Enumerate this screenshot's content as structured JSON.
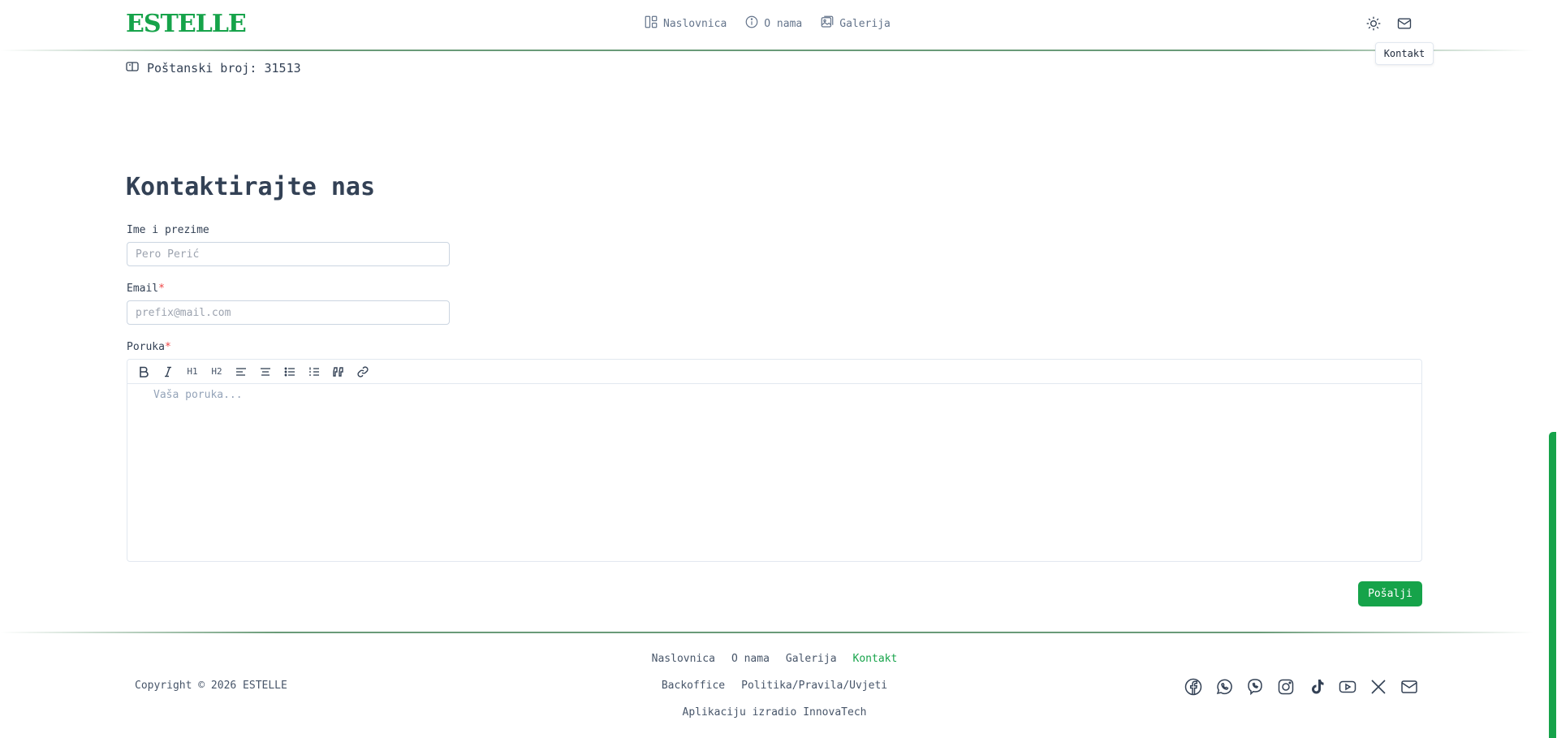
{
  "header": {
    "logo": "ESTELLE",
    "nav": [
      {
        "label": "Naslovnica",
        "icon": "layout-icon"
      },
      {
        "label": "O nama",
        "icon": "info-icon"
      },
      {
        "label": "Galerija",
        "icon": "gallery-icon"
      }
    ],
    "theme_icon": "sun-icon",
    "contact_icon": "mail-icon",
    "tooltip": "Kontakt"
  },
  "info": {
    "postal_label": "Poštanski broj: 31513"
  },
  "form": {
    "title": "Kontaktirajte nas",
    "name_label": "Ime i prezime",
    "name_placeholder": "Pero Perić",
    "email_label": "Email",
    "email_placeholder": "prefix@mail.com",
    "message_label": "Poruka",
    "required_mark": "*",
    "toolbar": [
      "bold",
      "italic",
      "heading-1",
      "heading-2",
      "align-left",
      "align-center",
      "bullet-list",
      "ordered-list",
      "blockquote",
      "link"
    ],
    "toolbar_text": {
      "h1": "H1",
      "h2": "H2"
    },
    "message_placeholder": "Vaša poruka...",
    "submit": "Pošalji"
  },
  "footer": {
    "links_row1": [
      "Naslovnica",
      "O nama",
      "Galerija",
      "Kontakt"
    ],
    "active_link": "Kontakt",
    "links_row2": [
      "Backoffice",
      "Politika/Pravila/Uvjeti"
    ],
    "credit": "Aplikaciju izradio InnovaTech",
    "copyright": "Copyright © 2026 ESTELLE",
    "socials": [
      "facebook-icon",
      "whatsapp-icon",
      "viber-icon",
      "instagram-icon",
      "tiktok-icon",
      "youtube-icon",
      "x-icon",
      "mail-icon"
    ]
  },
  "colors": {
    "accent": "#16a34a",
    "text": "#334155",
    "required": "#ef4444"
  }
}
